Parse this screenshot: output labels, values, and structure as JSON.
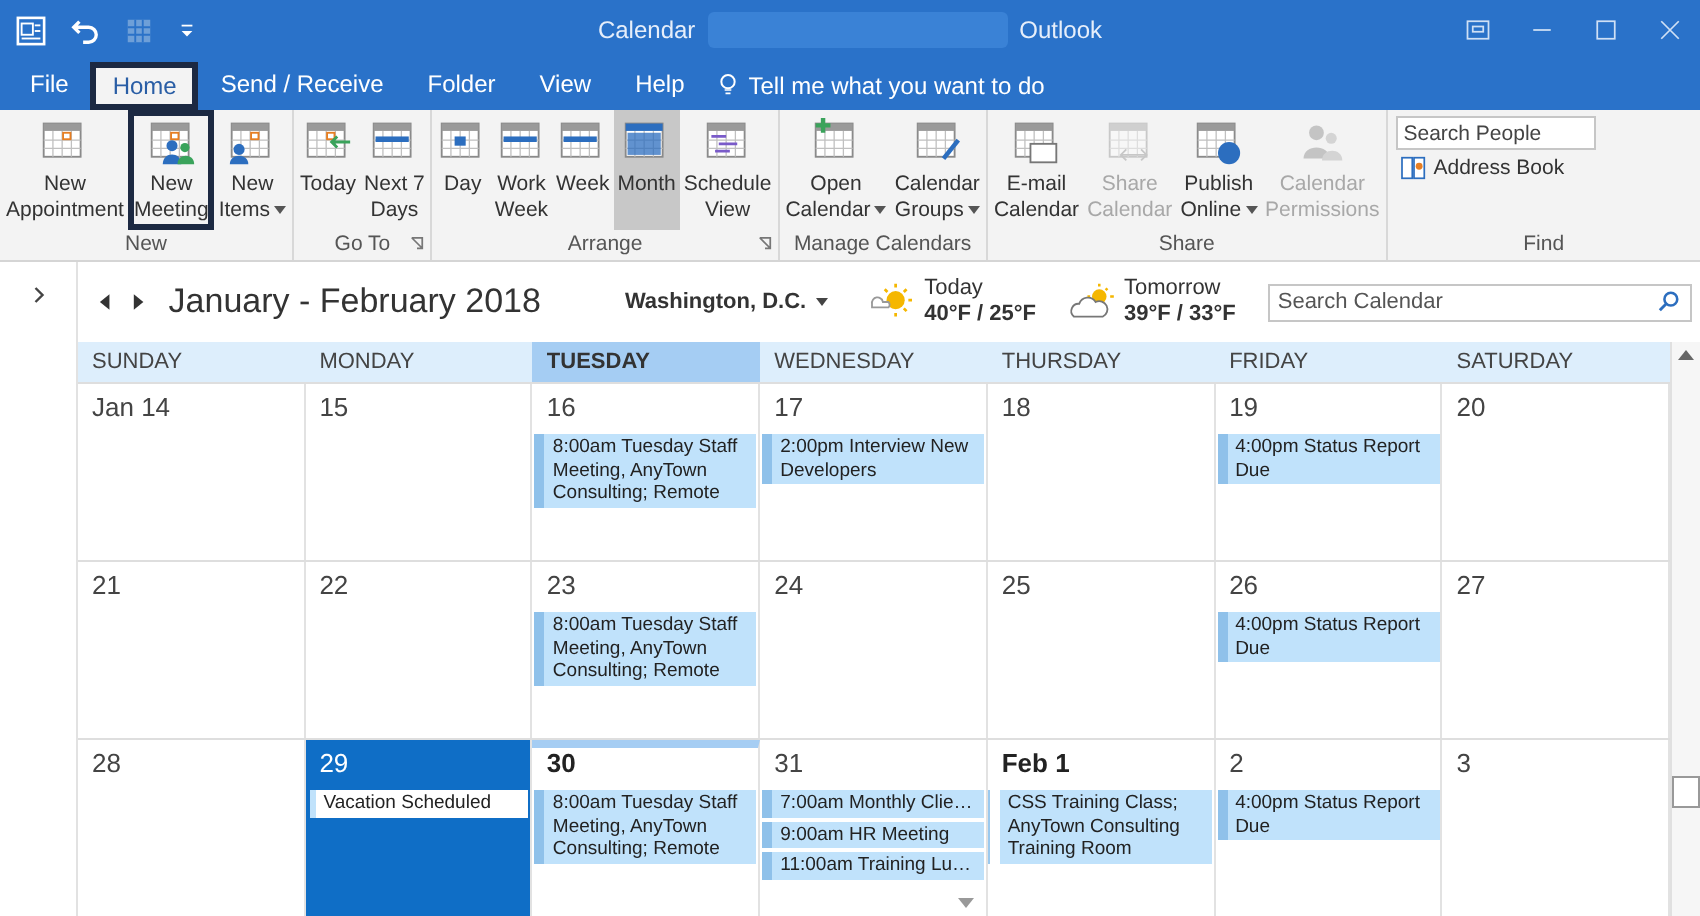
{
  "title_bar": {
    "title": "Calendar",
    "app": "Outlook",
    "quick_access": [
      {
        "kind": "app"
      },
      {
        "kind": "undo"
      },
      {
        "kind": "grid"
      },
      {
        "kind": "customize"
      }
    ]
  },
  "menu_tabs": [
    {
      "label": "File",
      "selected": false,
      "highlighted": false
    },
    {
      "label": "Home",
      "selected": true,
      "highlighted": true
    },
    {
      "label": "Send / Receive",
      "selected": false,
      "highlighted": false
    },
    {
      "label": "Folder",
      "selected": false,
      "highlighted": false
    },
    {
      "label": "View",
      "selected": false,
      "highlighted": false
    },
    {
      "label": "Help",
      "selected": false,
      "highlighted": false
    }
  ],
  "tell_me": "Tell me what you want to do",
  "ribbon_groups": [
    {
      "label": "New",
      "launcher": false,
      "buttons": [
        {
          "lines": [
            "New",
            "Appointment"
          ],
          "kind": "appointment",
          "disabled": false,
          "selected": false,
          "highlighted": false,
          "dropdown": false
        },
        {
          "lines": [
            "New",
            "Meeting"
          ],
          "kind": "meeting",
          "disabled": false,
          "selected": false,
          "highlighted": true,
          "dropdown": false
        },
        {
          "lines": [
            "New",
            "Items"
          ],
          "kind": "items",
          "disabled": false,
          "selected": false,
          "highlighted": false,
          "dropdown": true
        }
      ]
    },
    {
      "label": "Go To",
      "launcher": true,
      "buttons": [
        {
          "lines": [
            "Today"
          ],
          "kind": "today",
          "disabled": false,
          "selected": false,
          "highlighted": false,
          "dropdown": false
        },
        {
          "lines": [
            "Next 7",
            "Days"
          ],
          "kind": "week",
          "disabled": false,
          "selected": false,
          "highlighted": false,
          "dropdown": false
        }
      ]
    },
    {
      "label": "Arrange",
      "launcher": true,
      "buttons": [
        {
          "lines": [
            "Day"
          ],
          "kind": "day",
          "disabled": false,
          "selected": false,
          "highlighted": false,
          "dropdown": false
        },
        {
          "lines": [
            "Work",
            "Week"
          ],
          "kind": "week",
          "disabled": false,
          "selected": false,
          "highlighted": false,
          "dropdown": false
        },
        {
          "lines": [
            "Week"
          ],
          "kind": "week",
          "disabled": false,
          "selected": false,
          "highlighted": false,
          "dropdown": false
        },
        {
          "lines": [
            "Month"
          ],
          "kind": "month",
          "disabled": false,
          "selected": true,
          "highlighted": false,
          "dropdown": false
        },
        {
          "lines": [
            "Schedule",
            "View"
          ],
          "kind": "schedule",
          "disabled": false,
          "selected": false,
          "highlighted": false,
          "dropdown": false
        }
      ]
    },
    {
      "label": "Manage Calendars",
      "launcher": false,
      "buttons": [
        {
          "lines": [
            "Open",
            "Calendar"
          ],
          "kind": "open",
          "disabled": false,
          "selected": false,
          "highlighted": false,
          "dropdown": true
        },
        {
          "lines": [
            "Calendar",
            "Groups"
          ],
          "kind": "groups",
          "disabled": false,
          "selected": false,
          "highlighted": false,
          "dropdown": true
        }
      ]
    },
    {
      "label": "Share",
      "launcher": false,
      "buttons": [
        {
          "lines": [
            "E-mail",
            "Calendar"
          ],
          "kind": "email",
          "disabled": false,
          "selected": false,
          "highlighted": false,
          "dropdown": false
        },
        {
          "lines": [
            "Share",
            "Calendar"
          ],
          "kind": "share",
          "disabled": true,
          "selected": false,
          "highlighted": false,
          "dropdown": false
        },
        {
          "lines": [
            "Publish",
            "Online"
          ],
          "kind": "publish",
          "disabled": false,
          "selected": false,
          "highlighted": false,
          "dropdown": true
        },
        {
          "lines": [
            "Calendar",
            "Permissions"
          ],
          "kind": "permissions",
          "disabled": true,
          "selected": false,
          "highlighted": false,
          "dropdown": false
        }
      ]
    }
  ],
  "find": {
    "label": "Find",
    "search_placeholder": "Search People",
    "address_book": "Address Book"
  },
  "calendar_header": {
    "title": "January - February 2018",
    "location": "Washington, D.C.",
    "weather": [
      {
        "day": "Today",
        "temp": "40°F / 25°F",
        "kind": "sunny"
      },
      {
        "day": "Tomorrow",
        "temp": "39°F / 33°F",
        "kind": "cloudy"
      }
    ],
    "search_placeholder": "Search Calendar"
  },
  "days": [
    {
      "label": "SUNDAY",
      "selected": false
    },
    {
      "label": "MONDAY",
      "selected": false
    },
    {
      "label": "TUESDAY",
      "selected": true
    },
    {
      "label": "WEDNESDAY",
      "selected": false
    },
    {
      "label": "THURSDAY",
      "selected": false
    },
    {
      "label": "FRIDAY",
      "selected": false
    },
    {
      "label": "SATURDAY",
      "selected": false
    }
  ],
  "weeks": [
    [
      {
        "date": "Jan 14",
        "bold": false,
        "selected": false,
        "today": false,
        "more": false
      },
      {
        "date": "15",
        "bold": false,
        "selected": false,
        "today": false,
        "more": false
      },
      {
        "date": "16",
        "bold": false,
        "selected": false,
        "today": false,
        "more": false,
        "events": [
          {
            "text": "8:00am Tuesday Staff Meeting, AnyTown Consulting; Remote",
            "kind": "busy"
          }
        ]
      },
      {
        "date": "17",
        "bold": false,
        "selected": false,
        "today": false,
        "more": false,
        "events": [
          {
            "text": "2:00pm Interview New Developers",
            "kind": "busy"
          }
        ]
      },
      {
        "date": "18",
        "bold": false,
        "selected": false,
        "today": false,
        "more": false
      },
      {
        "date": "19",
        "bold": false,
        "selected": false,
        "today": false,
        "more": false,
        "events": [
          {
            "text": "4:00pm Status Report Due",
            "kind": "busy"
          }
        ]
      },
      {
        "date": "20",
        "bold": false,
        "selected": false,
        "today": false,
        "more": false
      }
    ],
    [
      {
        "date": "21",
        "bold": false,
        "selected": false,
        "today": false,
        "more": false
      },
      {
        "date": "22",
        "bold": false,
        "selected": false,
        "today": false,
        "more": false
      },
      {
        "date": "23",
        "bold": false,
        "selected": false,
        "today": false,
        "more": false,
        "events": [
          {
            "text": "8:00am Tuesday Staff Meeting, AnyTown Consulting; Remote",
            "kind": "busy"
          }
        ]
      },
      {
        "date": "24",
        "bold": false,
        "selected": false,
        "today": false,
        "more": false
      },
      {
        "date": "25",
        "bold": false,
        "selected": false,
        "today": false,
        "more": false
      },
      {
        "date": "26",
        "bold": false,
        "selected": false,
        "today": false,
        "more": false,
        "events": [
          {
            "text": "4:00pm Status Report Due",
            "kind": "busy"
          }
        ]
      },
      {
        "date": "27",
        "bold": false,
        "selected": false,
        "today": false,
        "more": false
      }
    ],
    [
      {
        "date": "28",
        "bold": false,
        "selected": false,
        "today": false,
        "more": false
      },
      {
        "date": "29",
        "bold": false,
        "selected": true,
        "today": false,
        "more": false,
        "events": [
          {
            "text": "Vacation Scheduled",
            "kind": "free"
          }
        ]
      },
      {
        "date": "30",
        "bold": true,
        "selected": false,
        "today": true,
        "more": false,
        "events": [
          {
            "text": "8:00am Tuesday Staff Meeting, AnyTown Consulting; Remote",
            "kind": "busy"
          }
        ]
      },
      {
        "date": "31",
        "bold": false,
        "selected": false,
        "today": false,
        "more": true,
        "events": [
          {
            "text": "7:00am Monthly Clie…",
            "kind": "busy"
          },
          {
            "text": "9:00am HR Meeting",
            "kind": "busy"
          },
          {
            "text": "11:00am Training Lu…",
            "kind": "busy"
          }
        ]
      },
      {
        "date": "Feb 1",
        "bold": true,
        "selected": false,
        "today": false,
        "more": false,
        "events": [
          {
            "text": "CSS Training Class; AnyTown Consulting Training Room",
            "kind": "tentative"
          }
        ]
      },
      {
        "date": "2",
        "bold": false,
        "selected": false,
        "today": false,
        "more": false,
        "events": [
          {
            "text": "4:00pm Status Report Due",
            "kind": "busy"
          }
        ]
      },
      {
        "date": "3",
        "bold": false,
        "selected": false,
        "today": false,
        "more": false
      }
    ]
  ]
}
